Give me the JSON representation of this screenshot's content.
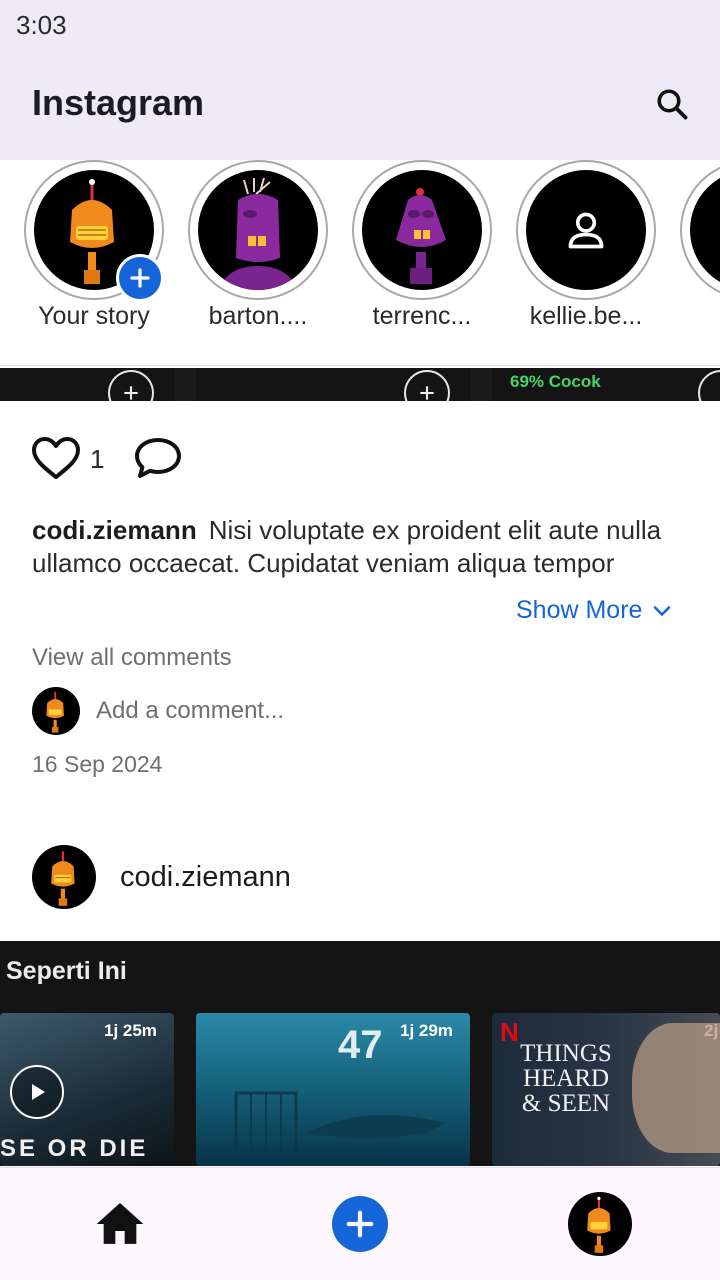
{
  "status_bar": {
    "time": "3:03"
  },
  "app_bar": {
    "title": "Instagram",
    "search_icon": "search-icon"
  },
  "stories": [
    {
      "label": "Your story",
      "avatar": "orange-robot-avatar",
      "has_add_badge": true
    },
    {
      "label": "barton....",
      "avatar": "purple-robot-avatar"
    },
    {
      "label": "terrenc...",
      "avatar": "purple-robot-avatar"
    },
    {
      "label": "kellie.be...",
      "avatar": "person-placeholder-icon"
    }
  ],
  "media_strip": {
    "score_text": "69% Cocok"
  },
  "post": {
    "like_count": "1",
    "caption_user": "codi.ziemann",
    "caption_text": "Nisi voluptate ex proident elit aute nulla ullamco occaecat. Cupidatat veniam aliqua tempor",
    "show_more_label": "Show More",
    "view_comments_label": "View all comments",
    "comment_placeholder": "Add a comment...",
    "date": "16 Sep 2024"
  },
  "next_post": {
    "username": "codi.ziemann",
    "media_title": "Seperti Ini",
    "thumbnails": [
      {
        "duration": "1j 25m",
        "caption": "SE OR DIE"
      },
      {
        "duration": "1j 29m",
        "caption": "47"
      },
      {
        "duration": "2j",
        "caption": "THINGS HEARD & SEEN"
      }
    ]
  },
  "bottom_nav": {
    "home_icon": "home-icon",
    "add_icon": "add-icon",
    "profile_icon": "profile-avatar"
  },
  "colors": {
    "accent": "#1565d8",
    "app_bar_bg": "#efeaf8",
    "nav_bg": "#fdf7ff",
    "match_green": "#46d369"
  }
}
